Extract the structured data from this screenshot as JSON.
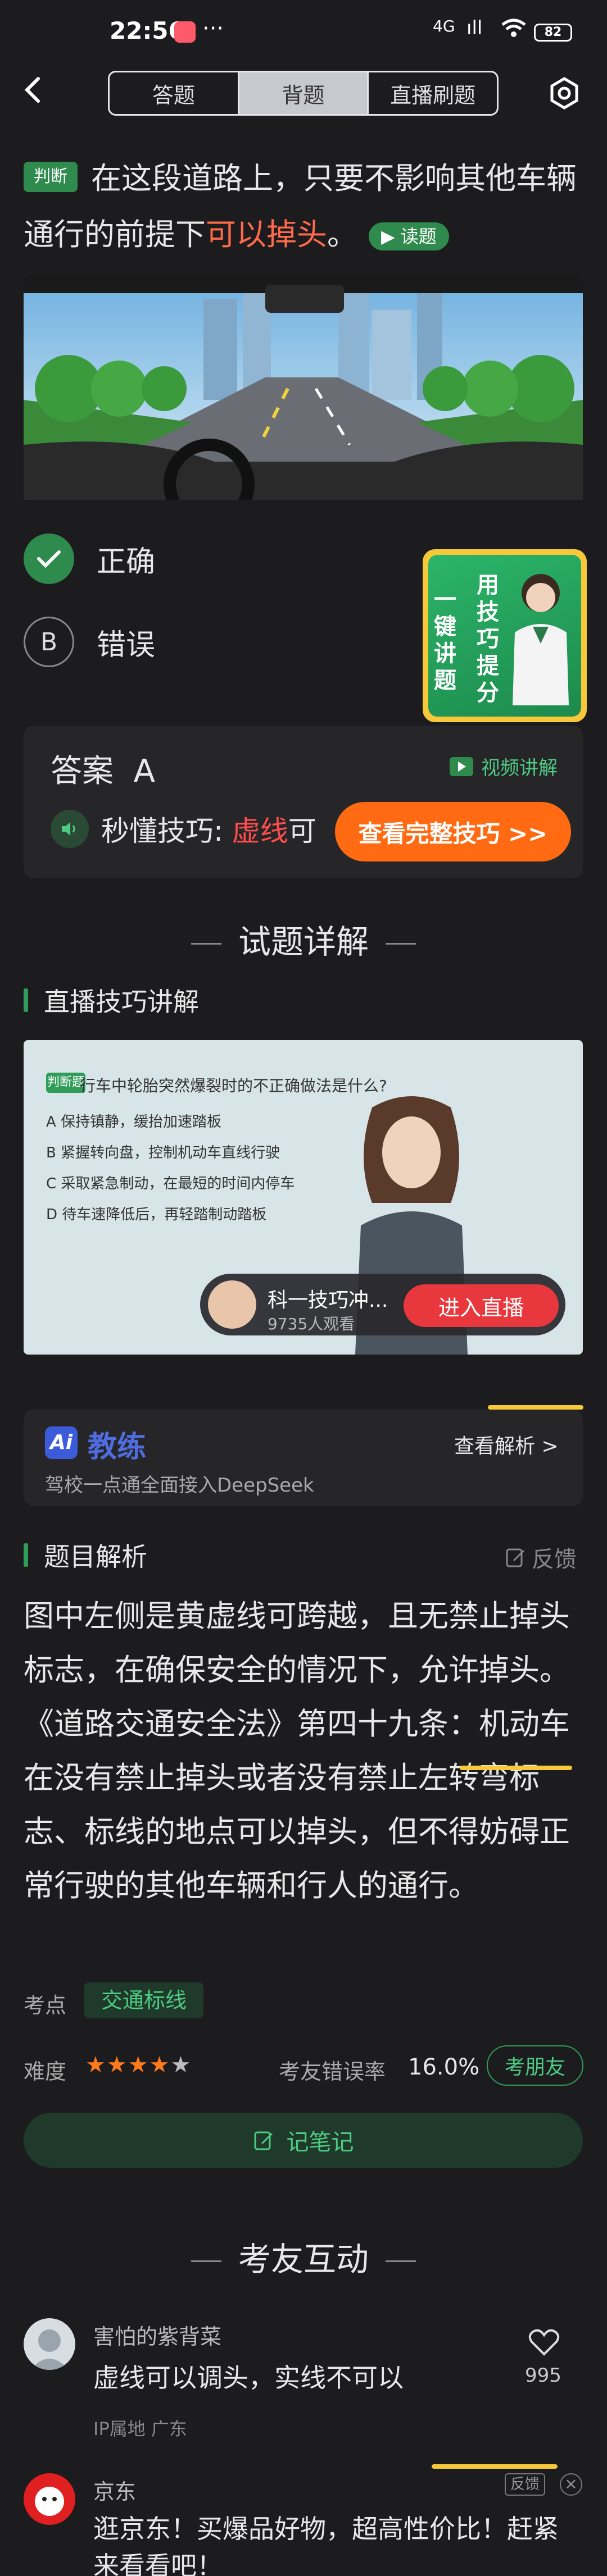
{
  "status_bar": {
    "time": "22:56",
    "more": "···",
    "signal1": "4G",
    "signal2": "ıll",
    "battery": "82"
  },
  "nav": {
    "back_icon": "chevron-left-icon",
    "tabs": [
      {
        "label": "答题",
        "active": false
      },
      {
        "label": "背题",
        "active": true
      },
      {
        "label": "直播刷题",
        "active": false
      }
    ],
    "settings_icon": "settings-icon"
  },
  "question": {
    "type_tag": "判断",
    "text_before": "在这段道路上，只要不影响其他车辆通行的前提下",
    "text_highlight": "可以掉头",
    "text_after": "。",
    "read_button": "读题"
  },
  "options": [
    {
      "letter": "A",
      "label": "正确",
      "selected": true
    },
    {
      "letter": "B",
      "label": "错误",
      "selected": false
    }
  ],
  "promo": {
    "left": "一键讲题",
    "right": "用技巧提分"
  },
  "answer": {
    "label": "答案",
    "value": "A",
    "video_explain": "视频讲解",
    "tip_prefix": "秒懂技巧:",
    "tip_red": "虚线",
    "tip_rest": "可",
    "full_tip_button": "查看完整技巧 >>"
  },
  "sections": {
    "detail_title": "试题详解",
    "live_tip_title": "直播技巧讲解",
    "analysis_title": "题目解析",
    "community_title": "考友互动"
  },
  "video": {
    "tag": "判断题",
    "question": "行车中轮胎突然爆裂时的不正确做法是什么?",
    "options": [
      "A  保持镇静，缓抬加速踏板",
      "B  紧握转向盘，控制机动车直线行驶",
      "C  采取紧急制动，在最短的时间内停车",
      "D  待车速降低后，再轻踏制动踏板"
    ],
    "live_name": "科一技巧冲...",
    "live_viewers": "9735人观看",
    "enter_live": "进入直播"
  },
  "coach": {
    "logo": "Ai",
    "name": "教练",
    "subtitle": "驾校一点通全面接入DeepSeek",
    "link": "查看解析 >"
  },
  "analysis": {
    "feedback": "反馈",
    "paragraphs": [
      "图中左侧是黄虚线可跨越，且无禁止掉头标志，在确保安全的情况下，允许掉头。",
      "《道路交通安全法》第四十九条：机动车在没有禁止掉头或者没有禁止左转弯标志、标线的地点可以掉头，但不得妨碍正常行驶的其他车辆和行人的通行。"
    ],
    "kp_label": "考点",
    "kp_tag": "交通标线",
    "difficulty_label": "难度",
    "difficulty_stars": 4,
    "difficulty_max": 5,
    "error_rate_label": "考友错误率",
    "error_rate": "16.0%",
    "test_friends": "考朋友",
    "note_button": "记笔记"
  },
  "comments": [
    {
      "name": "害怕的紫背菜",
      "text": "虚线可以调头，实线不可以",
      "ip": "IP属地 广东",
      "likes": "995"
    },
    {
      "name": "京东",
      "text": "逛京东！买爆品好物，超高性价比！赶紧来看看吧！",
      "ad_tag": "反馈",
      "close": "×"
    }
  ],
  "colors": {
    "accent_green": "#2f8a4e",
    "highlight_red": "#ff6b4a",
    "cta_orange": "#ff6a13",
    "live_red": "#e8383d",
    "star_orange": "#ff7a1a",
    "coach_blue": "#4f6de0"
  }
}
